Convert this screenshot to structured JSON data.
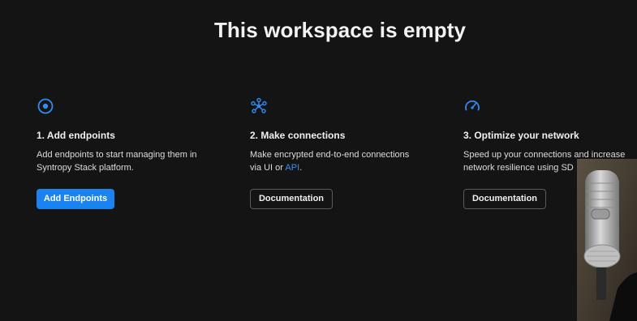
{
  "title": "This workspace is empty",
  "steps": [
    {
      "icon": "target-icon",
      "heading": "1. Add endpoints",
      "desc_line1": "Add endpoints to start managing them in",
      "desc_line2": "Syntropy Stack platform.",
      "button": "Add Endpoints"
    },
    {
      "icon": "network-icon",
      "heading": "2. Make connections",
      "desc_line1": "Make encrypted end-to-end connections",
      "desc_line2_prefix": "via UI or ",
      "desc_line2_link": "API",
      "desc_line2_suffix": ".",
      "button": "Documentation"
    },
    {
      "icon": "speedometer-icon",
      "heading": "3. Optimize your network",
      "desc_line1": "Speed up your connections and increase",
      "desc_line2": "network resilience using SD",
      "button": "Documentation"
    }
  ],
  "colors": {
    "background": "#141414",
    "accent": "#1a83f0",
    "link": "#3c8ff0"
  }
}
